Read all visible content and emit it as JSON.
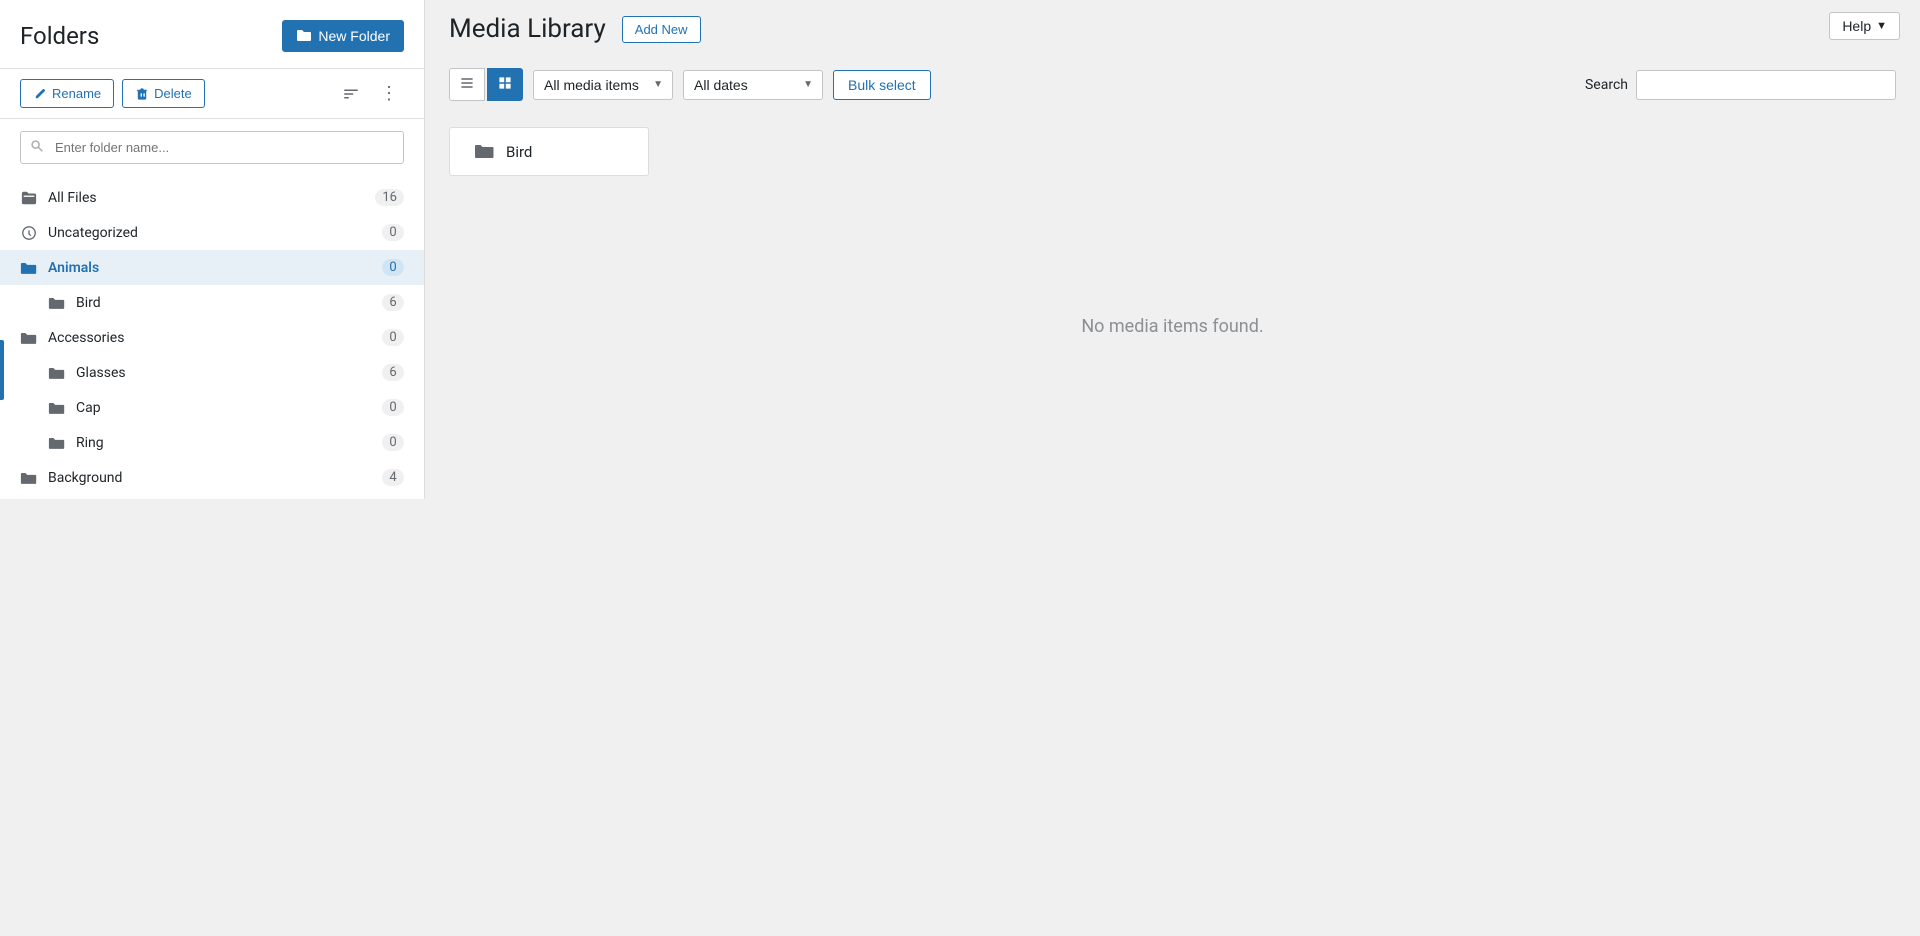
{
  "help_button": {
    "label": "Help",
    "chevron": "▼"
  },
  "sidebar": {
    "title": "Folders",
    "new_folder_button": "New Folder",
    "rename_button": "Rename",
    "delete_button": "Delete",
    "search_placeholder": "Enter folder name...",
    "folders": [
      {
        "id": "all-files",
        "name": "All Files",
        "count": 16,
        "level": 0,
        "active": false,
        "icon_type": "all"
      },
      {
        "id": "uncategorized",
        "name": "Uncategorized",
        "count": 0,
        "level": 0,
        "active": false,
        "icon_type": "uncategorized"
      },
      {
        "id": "animals",
        "name": "Animals",
        "count": 0,
        "level": 0,
        "active": true,
        "icon_type": "folder-blue"
      },
      {
        "id": "bird",
        "name": "Bird",
        "count": 6,
        "level": 1,
        "active": false,
        "icon_type": "folder"
      },
      {
        "id": "accessories",
        "name": "Accessories",
        "count": 0,
        "level": 0,
        "active": false,
        "icon_type": "folder"
      },
      {
        "id": "glasses",
        "name": "Glasses",
        "count": 6,
        "level": 1,
        "active": false,
        "icon_type": "folder"
      },
      {
        "id": "cap",
        "name": "Cap",
        "count": 0,
        "level": 1,
        "active": false,
        "icon_type": "folder"
      },
      {
        "id": "ring",
        "name": "Ring",
        "count": 0,
        "level": 1,
        "active": false,
        "icon_type": "folder"
      },
      {
        "id": "background",
        "name": "Background",
        "count": 4,
        "level": 0,
        "active": false,
        "icon_type": "folder"
      }
    ]
  },
  "main": {
    "title": "Media Library",
    "add_new_label": "Add New",
    "filter": {
      "all_media_label": "All media items",
      "all_dates_label": "All dates",
      "bulk_select_label": "Bulk select",
      "search_label": "Search",
      "search_placeholder": ""
    },
    "media_folder_card": {
      "name": "Bird"
    },
    "no_media_message": "No media items found."
  }
}
